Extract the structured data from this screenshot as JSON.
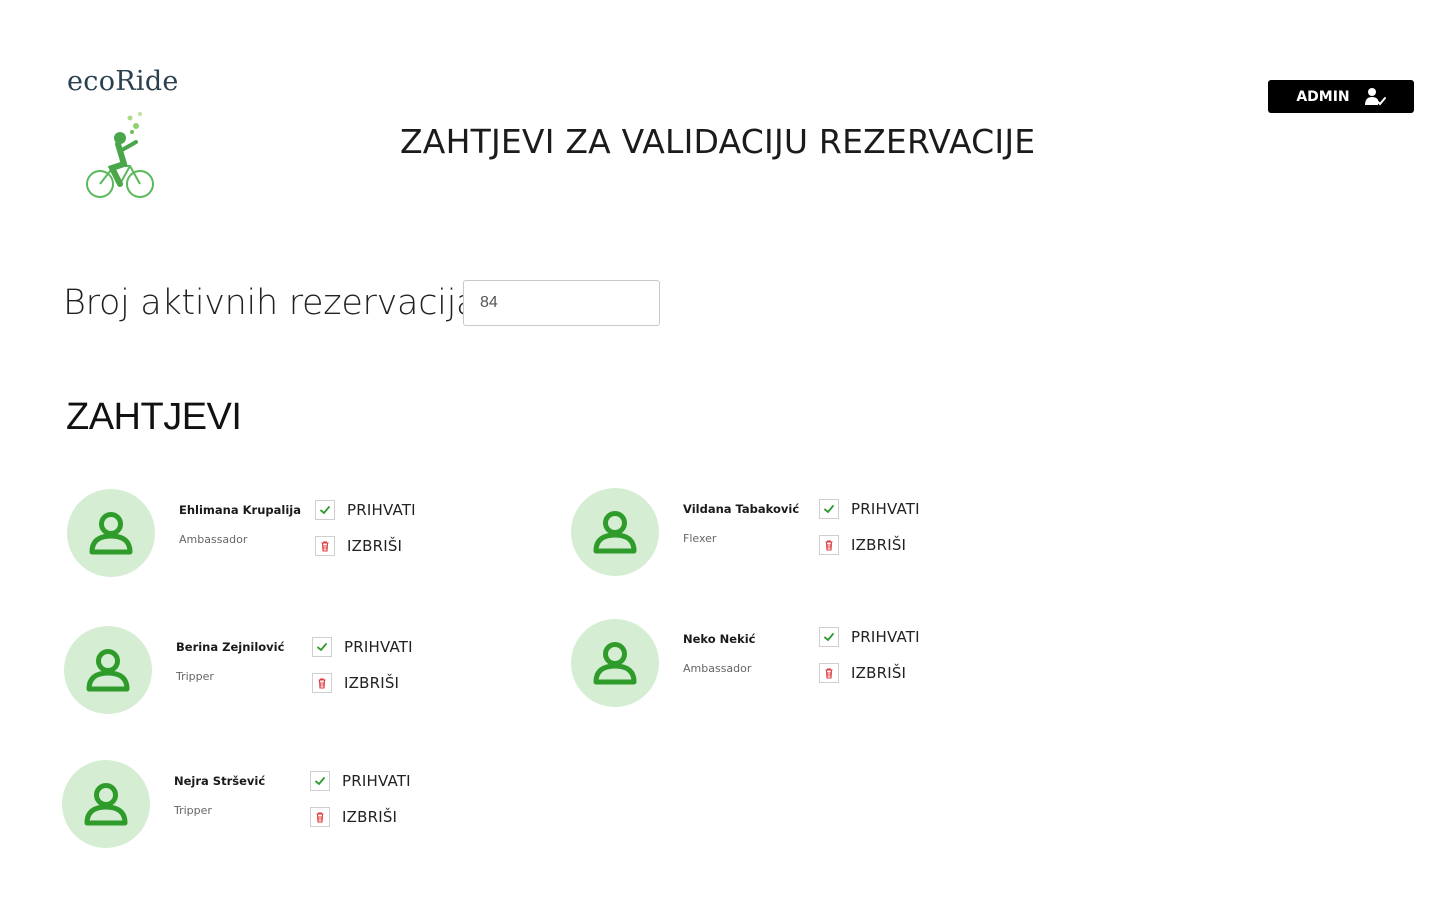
{
  "brand": {
    "name": "ecoRide",
    "logo_icon": "cyclist-logo-icon"
  },
  "header": {
    "title": "ZAHTJEVI ZA VALIDACIJU REZERVACIJE",
    "admin_button": {
      "label": "ADMIN",
      "icon": "user-check-icon"
    }
  },
  "stats": {
    "active_label": "Broj aktivnih rezervacija:",
    "active_value": "84"
  },
  "requests": {
    "title": "ZAHTJEVI",
    "accept_label": "PRIHVATI",
    "delete_label": "IZBRIŠI",
    "items": [
      {
        "name": "Ehlimana Krupalija",
        "role": "Ambassador"
      },
      {
        "name": "Vildana Tabaković",
        "role": "Flexer"
      },
      {
        "name": "Berina Zejnilović",
        "role": "Tripper"
      },
      {
        "name": "Neko Nekić",
        "role": "Ambassador"
      },
      {
        "name": "Nejra Stršević",
        "role": "Tripper"
      }
    ]
  },
  "colors": {
    "accent_green": "#2e9b2b",
    "avatar_bg": "#d5edd3",
    "delete_red": "#e03a3a",
    "button_bg": "#000000"
  }
}
